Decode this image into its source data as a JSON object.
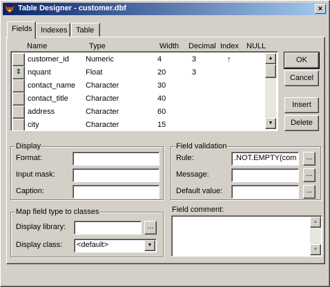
{
  "window": {
    "title": "Table Designer - customer.dbf",
    "close_glyph": "×"
  },
  "tabs": [
    {
      "label": "Fields",
      "active": true
    },
    {
      "label": "Indexes",
      "active": false
    },
    {
      "label": "Table",
      "active": false
    }
  ],
  "grid": {
    "columns": [
      "Name",
      "Type",
      "Width",
      "Decimal",
      "Index",
      "NULL"
    ],
    "rows": [
      {
        "name": "customer_id",
        "type": "Numeric",
        "width": "4",
        "decimal": "3",
        "index": "↑",
        "selector": ""
      },
      {
        "name": "nquant",
        "type": "Float",
        "width": "20",
        "decimal": "3",
        "index": "",
        "selector": "⇕"
      },
      {
        "name": "contact_name",
        "type": "Character",
        "width": "30",
        "decimal": "",
        "index": "",
        "selector": ""
      },
      {
        "name": "contact_title",
        "type": "Character",
        "width": "40",
        "decimal": "",
        "index": "",
        "selector": ""
      },
      {
        "name": "address",
        "type": "Character",
        "width": "60",
        "decimal": "",
        "index": "",
        "selector": ""
      },
      {
        "name": "city",
        "type": "Character",
        "width": "15",
        "decimal": "",
        "index": "",
        "selector": ""
      }
    ],
    "scroll_up_glyph": "▲",
    "scroll_down_glyph": "▼"
  },
  "buttons": {
    "ok": "OK",
    "cancel": "Cancel",
    "insert": "Insert",
    "delete": "Delete"
  },
  "display": {
    "title": "Display",
    "format_label": "Format:",
    "input_mask_label": "Input mask:",
    "caption_label": "Caption:",
    "format_value": "",
    "input_mask_value": "",
    "caption_value": ""
  },
  "map": {
    "title": "Map field type to classes",
    "library_label": "Display library:",
    "class_label": "Display class:",
    "library_value": "",
    "class_value": "<default>",
    "ellipsis": "...",
    "dropdown_glyph": "▼"
  },
  "validation": {
    "title": "Field validation",
    "rule_label": "Rule:",
    "message_label": "Message:",
    "default_label": "Default value:",
    "rule_value": ".NOT.EMPTY(com",
    "message_value": "",
    "default_value": "",
    "ellipsis": "..."
  },
  "comment": {
    "label": "Field comment:",
    "value": "",
    "scroll_up_glyph": "▲",
    "scroll_down_glyph": "▼"
  },
  "colors": {
    "titlebar_start": "#0a246a",
    "titlebar_end": "#a6caf0",
    "face": "#d4d0c8"
  }
}
